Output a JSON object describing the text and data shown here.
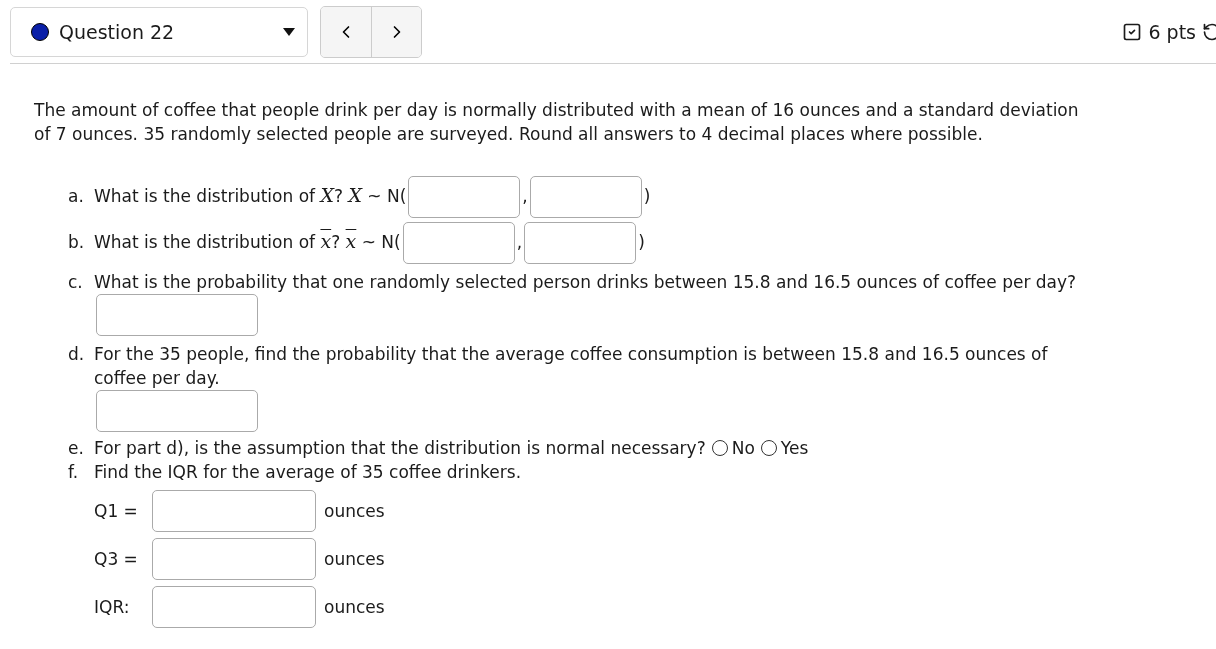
{
  "header": {
    "question": "Question 22",
    "points": "6 pts"
  },
  "problem": "The amount of coffee that people drink per day is normally distributed with a mean of 16 ounces and a standard deviation of 7 ounces. 35 randomly selected people are surveyed. Round all answers to 4 decimal places where possible.",
  "parts": [
    {
      "kind": "distribution",
      "marker": "a.",
      "prompt": "What is the distribution of",
      "variable": "X",
      "overline": false,
      "after_variable": "?",
      "symbol_variable": "X",
      "notation": "~ N(",
      "separator": ",",
      "close": ")"
    },
    {
      "kind": "distribution",
      "marker": "b.",
      "prompt": "What is the distribution of",
      "variable": "x",
      "overline": true,
      "after_variable": "?",
      "symbol_variable": "x",
      "notation": "~ N(",
      "separator": ",",
      "close": ")"
    },
    {
      "kind": "answer",
      "marker": "c.",
      "prompt": "What is the probability that one randomly selected person drinks between 15.8 and 16.5 ounces of coffee per day?"
    },
    {
      "kind": "answer",
      "marker": "d.",
      "prompt": "For the 35 people, find the probability that the average coffee consumption is between 15.8 and 16.5 ounces of coffee per day."
    },
    {
      "kind": "radio",
      "marker": "e.",
      "prompt": "For part d), is the assumption that the distribution is normal necessary?",
      "options": [
        {
          "label": "No",
          "selected": false
        },
        {
          "label": "Yes",
          "selected": false
        }
      ]
    },
    {
      "kind": "iqr",
      "marker": "f.",
      "prompt": "Find the IQR for the average of 35 coffee drinkers.",
      "rows": [
        {
          "label": "Q1 =",
          "unit": "ounces"
        },
        {
          "label": "Q3 =",
          "unit": "ounces"
        },
        {
          "label": "IQR:",
          "unit": "ounces"
        }
      ]
    }
  ]
}
